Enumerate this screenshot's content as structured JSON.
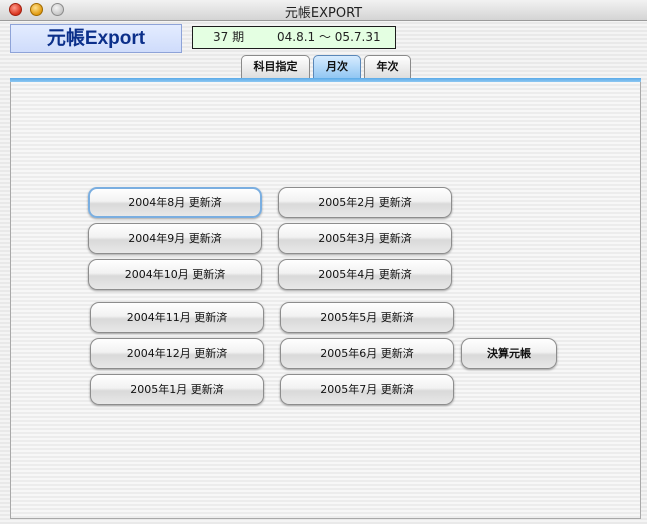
{
  "window": {
    "title": "元帳EXPORT"
  },
  "header": {
    "app_name": "元帳Export",
    "period_number": "37 期",
    "period_range": "04.8.1 ～ 05.7.31"
  },
  "tabs": [
    {
      "label": "科目指定",
      "active": false
    },
    {
      "label": "月次",
      "active": true
    },
    {
      "label": "年次",
      "active": false
    }
  ],
  "months_left": [
    "2004年8月 更新済",
    "2004年9月 更新済",
    "2004年10月 更新済",
    "2004年11月 更新済",
    "2004年12月 更新済",
    "2005年1月 更新済"
  ],
  "months_right": [
    "2005年2月 更新済",
    "2005年3月 更新済",
    "2005年4月 更新済",
    "2005年5月 更新済",
    "2005年6月 更新済",
    "2005年7月 更新済"
  ],
  "settlement_button": "決算元帳",
  "colors": {
    "accent_blue": "#5aaae8",
    "app_name_text": "#0b2f8a",
    "period_bg": "#e4ffe2",
    "focus_ring": "#7aaee0"
  }
}
